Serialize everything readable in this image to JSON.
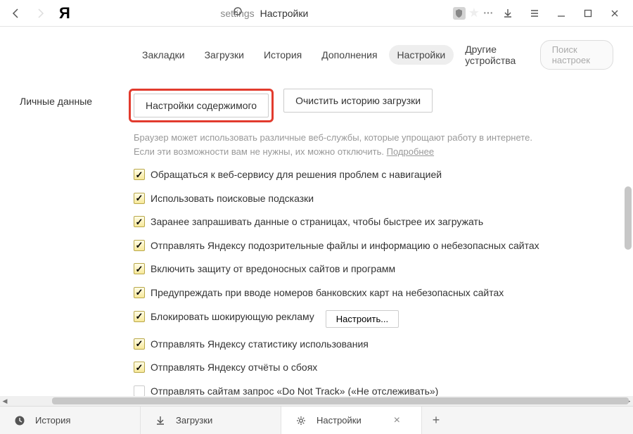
{
  "chrome": {
    "logo": "Я",
    "address_prefix": "settings",
    "address_title": "Настройки"
  },
  "nav": {
    "items": [
      {
        "label": "Закладки"
      },
      {
        "label": "Загрузки"
      },
      {
        "label": "История"
      },
      {
        "label": "Дополнения"
      },
      {
        "label": "Настройки",
        "active": true
      },
      {
        "label": "Другие устройства"
      }
    ],
    "search_placeholder": "Поиск настроек"
  },
  "section": {
    "title": "Личные данные",
    "content_settings_btn": "Настройки содержимого",
    "clear_history_btn": "Очистить историю загрузки",
    "hint1": "Браузер может использовать различные веб-службы, которые упрощают работу в интернете.",
    "hint2": "Если эти возможности вам не нужны, их можно отключить. ",
    "hint_link": "Подробнее",
    "configure_btn": "Настроить...",
    "checks": [
      {
        "label": "Обращаться к веб-сервису для решения проблем с навигацией",
        "checked": true
      },
      {
        "label": "Использовать поисковые подсказки",
        "checked": true
      },
      {
        "label": "Заранее запрашивать данные о страницах, чтобы быстрее их загружать",
        "checked": true
      },
      {
        "label": "Отправлять Яндексу подозрительные файлы и информацию о небезопасных сайтах",
        "checked": true
      },
      {
        "label": "Включить защиту от вредоносных сайтов и программ",
        "checked": true
      },
      {
        "label": "Предупреждать при вводе номеров банковских карт на небезопасных сайтах",
        "checked": true
      },
      {
        "label": "Блокировать шокирующую рекламу",
        "checked": true,
        "has_btn": true
      },
      {
        "label": "Отправлять Яндексу статистику использования",
        "checked": true
      },
      {
        "label": "Отправлять Яндексу отчёты о сбоях",
        "checked": true
      },
      {
        "label": "Отправлять сайтам запрос «Do Not Track» («Не отслеживать»)",
        "checked": false
      }
    ]
  },
  "tabs": [
    {
      "icon": "clock",
      "label": "История"
    },
    {
      "icon": "download",
      "label": "Загрузки"
    },
    {
      "icon": "gear",
      "label": "Настройки",
      "active": true,
      "closable": true
    }
  ]
}
